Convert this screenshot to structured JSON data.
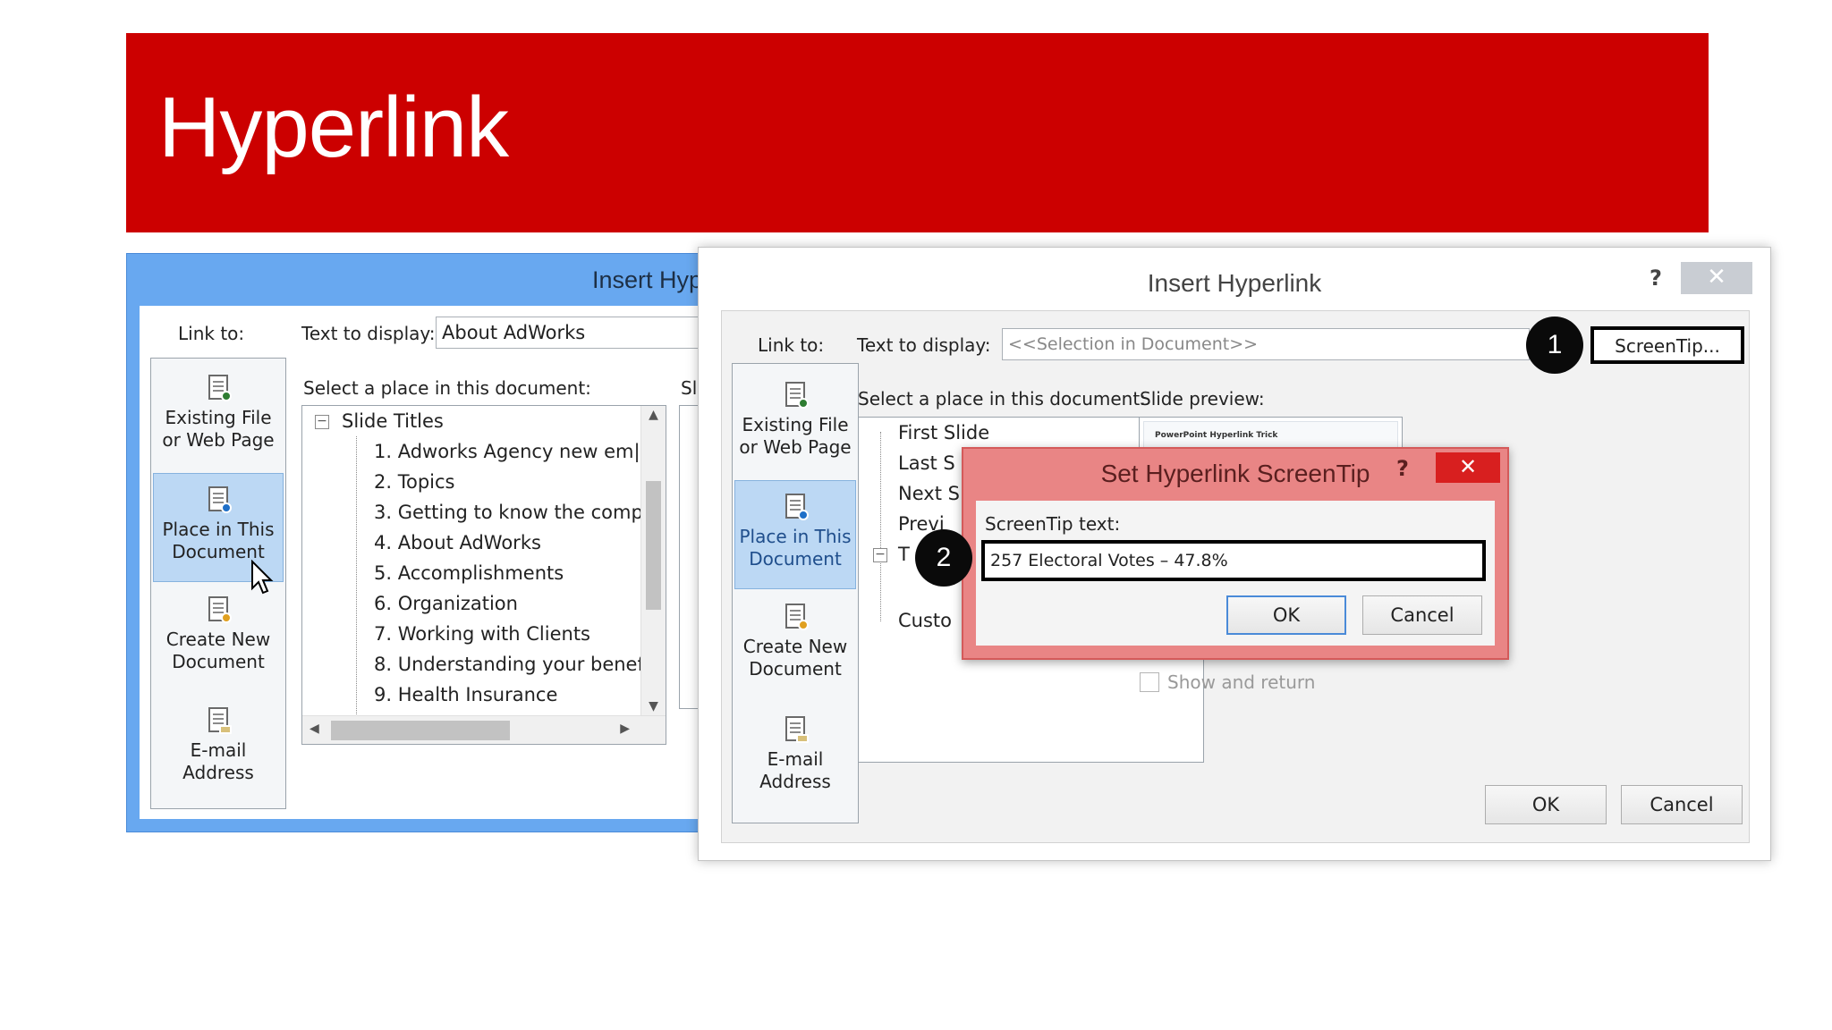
{
  "banner": {
    "title": "Hyperlink"
  },
  "colors": {
    "banner_red": "#cc0000",
    "dialog_blue": "#68a8f0",
    "screentip_red": "#e98585",
    "selected_blue": "#bcd8f4"
  },
  "back_dialog": {
    "title": "Insert Hyp",
    "link_to_label": "Link to:",
    "text_to_display_label": "Text to display:",
    "text_to_display_value": "About AdWorks",
    "select_place_label": "Select a place in this document:",
    "slide_preview_label_fragment": "Sli",
    "link_items": [
      {
        "line1": "Existing File",
        "line2": "or Web Page",
        "icon": "web-page-icon"
      },
      {
        "line1": "Place in This",
        "line2": "Document",
        "icon": "place-in-document-icon"
      },
      {
        "line1": "Create New",
        "line2": "Document",
        "icon": "new-document-icon"
      },
      {
        "line1": "E-mail",
        "line2": "Address",
        "icon": "email-icon"
      }
    ],
    "tree_root": "Slide Titles",
    "tree_items": [
      "1. Adworks Agency  new em|",
      "2. Topics",
      "3. Getting to know the comp",
      "4. About AdWorks",
      "5. Accomplishments",
      "6. Organization",
      "7. Working with Clients",
      "8. Understanding your benef",
      "9. Health Insurance"
    ]
  },
  "front_dialog": {
    "title": "Insert Hyperlink",
    "help": "?",
    "close": "✕",
    "link_to_label": "Link to:",
    "text_to_display_label": "Text to display:",
    "text_to_display_value": "<<Selection in Document>>",
    "screentip_button": "ScreenTip...",
    "select_place_label": "Select a place in this document:",
    "slide_preview_label": "Slide preview:",
    "link_items": [
      {
        "line1": "Existing File",
        "line2": "or Web Page",
        "icon": "web-page-icon"
      },
      {
        "line1": "Place in This",
        "line2": "Document",
        "icon": "place-in-document-icon"
      },
      {
        "line1": "Create New",
        "line2": "Document",
        "icon": "new-document-icon"
      },
      {
        "line1": "E-mail",
        "line2": "Address",
        "icon": "email-icon"
      }
    ],
    "tree_items": [
      "First Slide",
      "Last S",
      "Next S",
      "Previ",
      "T",
      "Custo"
    ],
    "preview_caption": "PowerPoint Hyperlink Trick",
    "show_and_return_label": "Show and return",
    "ok_label": "OK",
    "cancel_label": "Cancel"
  },
  "screentip_dialog": {
    "title": "Set Hyperlink ScreenTip",
    "help": "?",
    "close": "✕",
    "screentip_text_label": "ScreenTip text:",
    "screentip_text_value": "257 Electoral Votes – 47.8%",
    "ok_label": "OK",
    "cancel_label": "Cancel"
  },
  "markers": {
    "one": "1",
    "two": "2"
  }
}
